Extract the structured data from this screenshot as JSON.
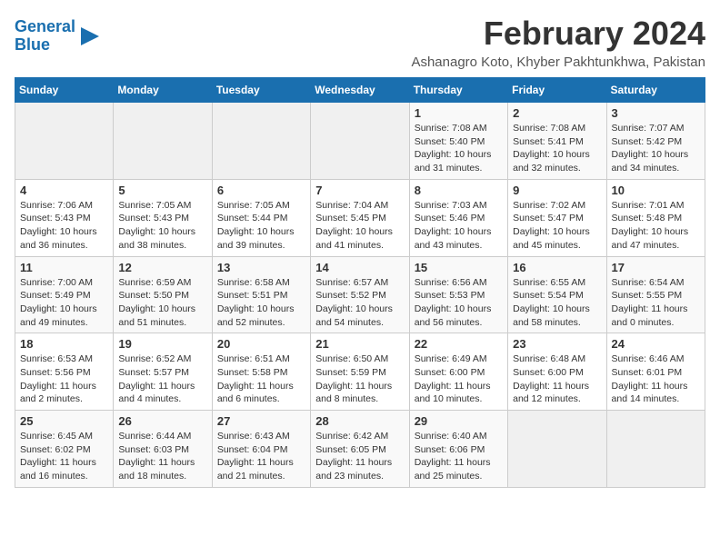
{
  "logo": {
    "line1": "General",
    "line2": "Blue"
  },
  "title": "February 2024",
  "location": "Ashanagro Koto, Khyber Pakhtunkhwa, Pakistan",
  "days_of_week": [
    "Sunday",
    "Monday",
    "Tuesday",
    "Wednesday",
    "Thursday",
    "Friday",
    "Saturday"
  ],
  "weeks": [
    [
      {
        "day": "",
        "info": ""
      },
      {
        "day": "",
        "info": ""
      },
      {
        "day": "",
        "info": ""
      },
      {
        "day": "",
        "info": ""
      },
      {
        "day": "1",
        "info": "Sunrise: 7:08 AM\nSunset: 5:40 PM\nDaylight: 10 hours and 31 minutes."
      },
      {
        "day": "2",
        "info": "Sunrise: 7:08 AM\nSunset: 5:41 PM\nDaylight: 10 hours and 32 minutes."
      },
      {
        "day": "3",
        "info": "Sunrise: 7:07 AM\nSunset: 5:42 PM\nDaylight: 10 hours and 34 minutes."
      }
    ],
    [
      {
        "day": "4",
        "info": "Sunrise: 7:06 AM\nSunset: 5:43 PM\nDaylight: 10 hours and 36 minutes."
      },
      {
        "day": "5",
        "info": "Sunrise: 7:05 AM\nSunset: 5:43 PM\nDaylight: 10 hours and 38 minutes."
      },
      {
        "day": "6",
        "info": "Sunrise: 7:05 AM\nSunset: 5:44 PM\nDaylight: 10 hours and 39 minutes."
      },
      {
        "day": "7",
        "info": "Sunrise: 7:04 AM\nSunset: 5:45 PM\nDaylight: 10 hours and 41 minutes."
      },
      {
        "day": "8",
        "info": "Sunrise: 7:03 AM\nSunset: 5:46 PM\nDaylight: 10 hours and 43 minutes."
      },
      {
        "day": "9",
        "info": "Sunrise: 7:02 AM\nSunset: 5:47 PM\nDaylight: 10 hours and 45 minutes."
      },
      {
        "day": "10",
        "info": "Sunrise: 7:01 AM\nSunset: 5:48 PM\nDaylight: 10 hours and 47 minutes."
      }
    ],
    [
      {
        "day": "11",
        "info": "Sunrise: 7:00 AM\nSunset: 5:49 PM\nDaylight: 10 hours and 49 minutes."
      },
      {
        "day": "12",
        "info": "Sunrise: 6:59 AM\nSunset: 5:50 PM\nDaylight: 10 hours and 51 minutes."
      },
      {
        "day": "13",
        "info": "Sunrise: 6:58 AM\nSunset: 5:51 PM\nDaylight: 10 hours and 52 minutes."
      },
      {
        "day": "14",
        "info": "Sunrise: 6:57 AM\nSunset: 5:52 PM\nDaylight: 10 hours and 54 minutes."
      },
      {
        "day": "15",
        "info": "Sunrise: 6:56 AM\nSunset: 5:53 PM\nDaylight: 10 hours and 56 minutes."
      },
      {
        "day": "16",
        "info": "Sunrise: 6:55 AM\nSunset: 5:54 PM\nDaylight: 10 hours and 58 minutes."
      },
      {
        "day": "17",
        "info": "Sunrise: 6:54 AM\nSunset: 5:55 PM\nDaylight: 11 hours and 0 minutes."
      }
    ],
    [
      {
        "day": "18",
        "info": "Sunrise: 6:53 AM\nSunset: 5:56 PM\nDaylight: 11 hours and 2 minutes."
      },
      {
        "day": "19",
        "info": "Sunrise: 6:52 AM\nSunset: 5:57 PM\nDaylight: 11 hours and 4 minutes."
      },
      {
        "day": "20",
        "info": "Sunrise: 6:51 AM\nSunset: 5:58 PM\nDaylight: 11 hours and 6 minutes."
      },
      {
        "day": "21",
        "info": "Sunrise: 6:50 AM\nSunset: 5:59 PM\nDaylight: 11 hours and 8 minutes."
      },
      {
        "day": "22",
        "info": "Sunrise: 6:49 AM\nSunset: 6:00 PM\nDaylight: 11 hours and 10 minutes."
      },
      {
        "day": "23",
        "info": "Sunrise: 6:48 AM\nSunset: 6:00 PM\nDaylight: 11 hours and 12 minutes."
      },
      {
        "day": "24",
        "info": "Sunrise: 6:46 AM\nSunset: 6:01 PM\nDaylight: 11 hours and 14 minutes."
      }
    ],
    [
      {
        "day": "25",
        "info": "Sunrise: 6:45 AM\nSunset: 6:02 PM\nDaylight: 11 hours and 16 minutes."
      },
      {
        "day": "26",
        "info": "Sunrise: 6:44 AM\nSunset: 6:03 PM\nDaylight: 11 hours and 18 minutes."
      },
      {
        "day": "27",
        "info": "Sunrise: 6:43 AM\nSunset: 6:04 PM\nDaylight: 11 hours and 21 minutes."
      },
      {
        "day": "28",
        "info": "Sunrise: 6:42 AM\nSunset: 6:05 PM\nDaylight: 11 hours and 23 minutes."
      },
      {
        "day": "29",
        "info": "Sunrise: 6:40 AM\nSunset: 6:06 PM\nDaylight: 11 hours and 25 minutes."
      },
      {
        "day": "",
        "info": ""
      },
      {
        "day": "",
        "info": ""
      }
    ]
  ]
}
